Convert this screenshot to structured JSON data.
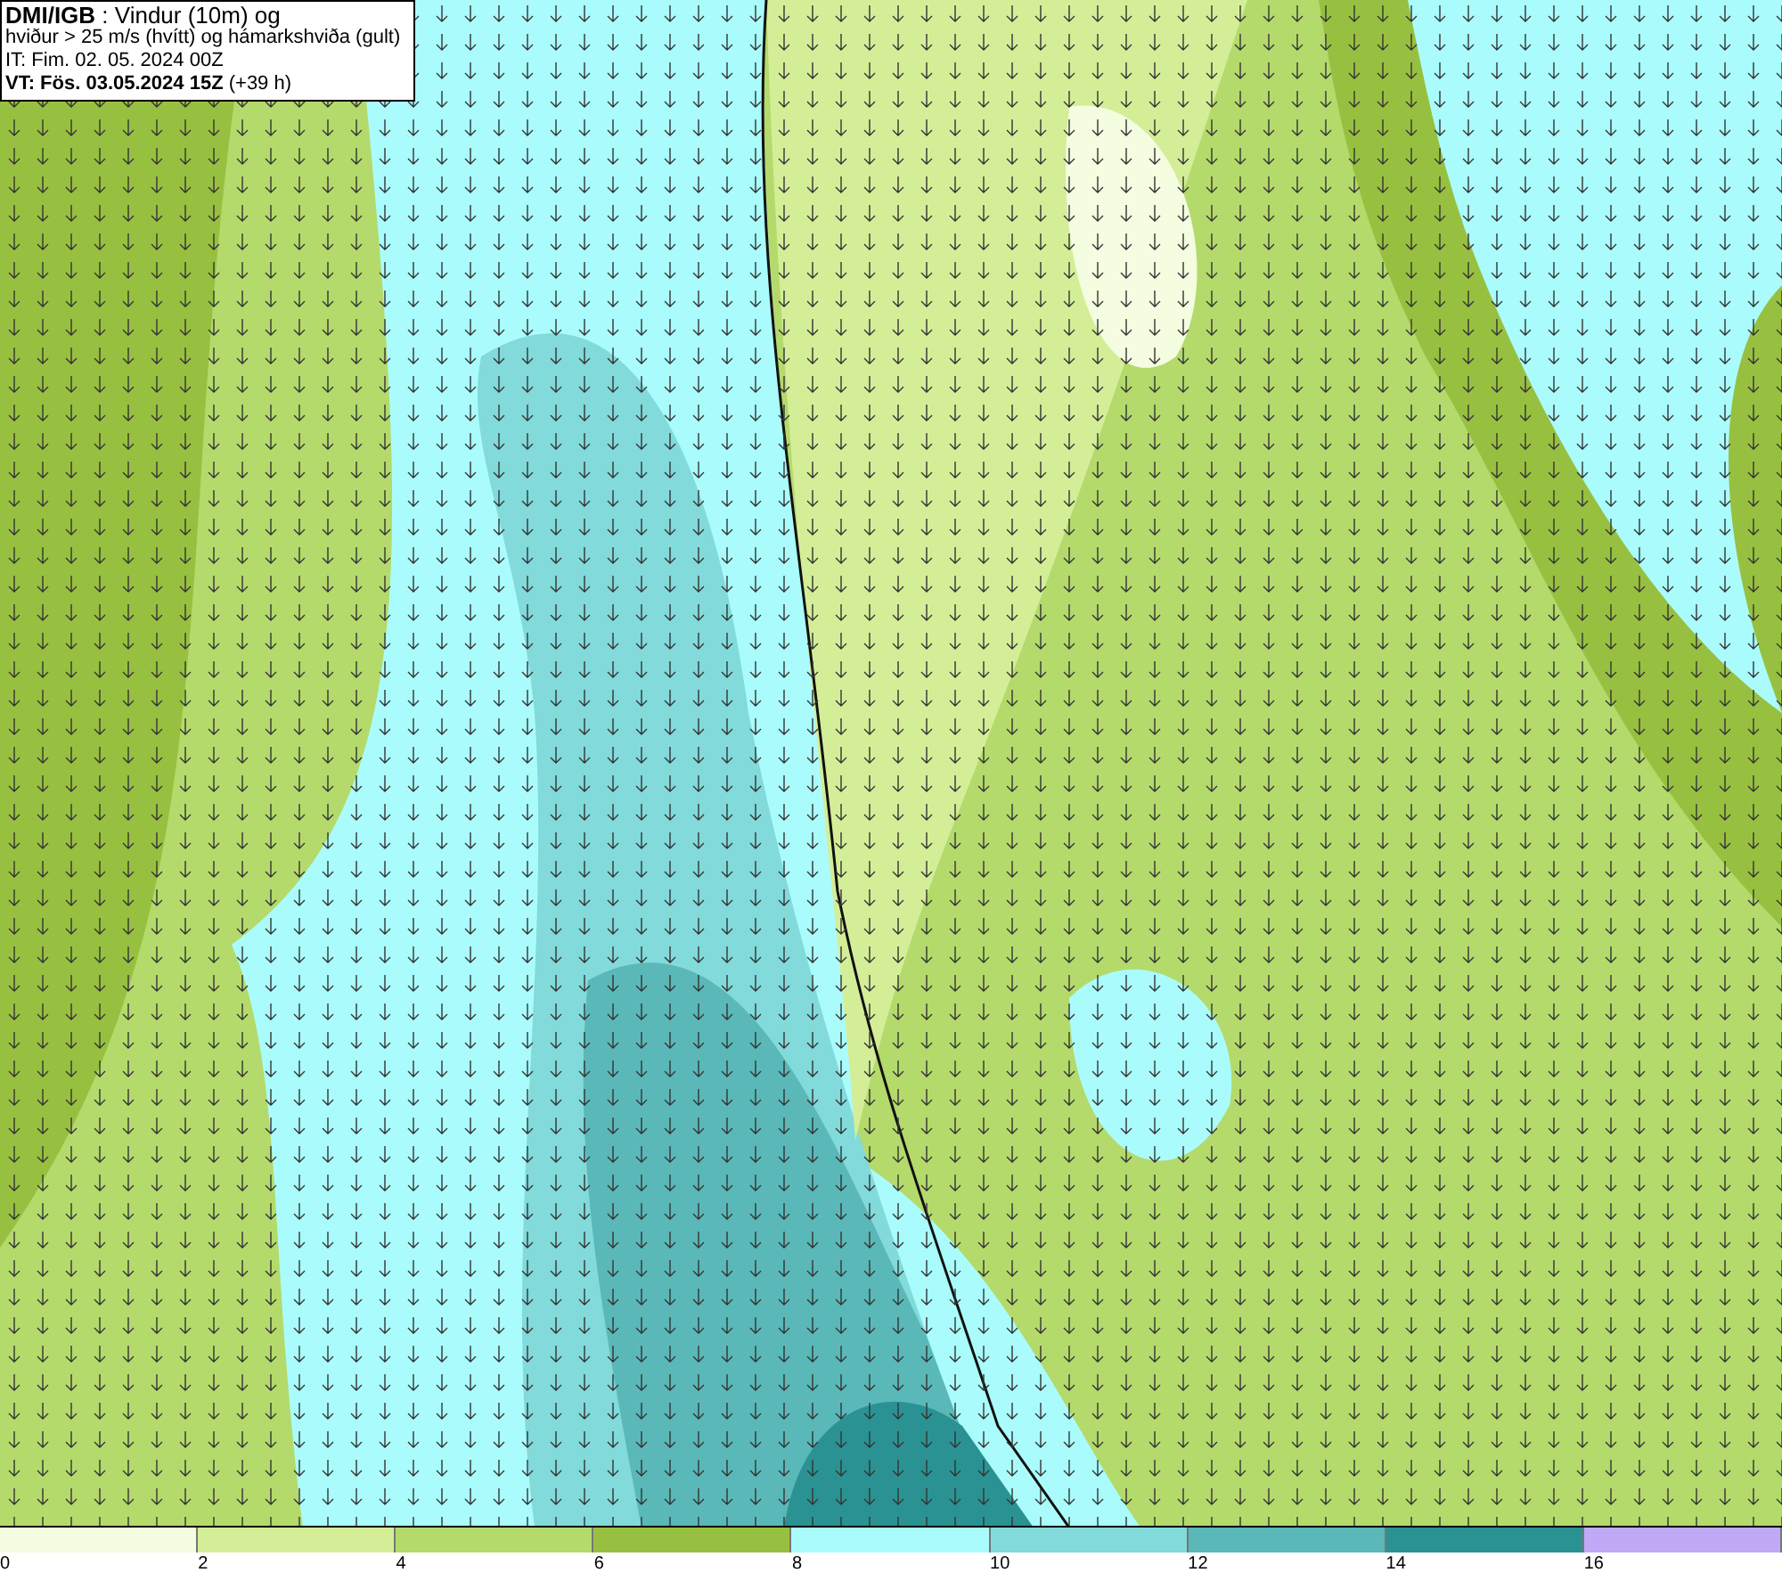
{
  "info_box": {
    "lines": [
      "**DMI/IGB** : Vindur (10m) og",
      "hviður > 25 m/s (hvítt) og hámarkshviða (gult)",
      "IT: Fim. 02. 05. 2024 00Z",
      "**VT: Fös. 03.05.2024 15Z** (+39 h)"
    ]
  },
  "legend": [
    {
      "label": "0",
      "color": "#f4fde0"
    },
    {
      "label": "2",
      "color": "#d4ee98"
    },
    {
      "label": "4",
      "color": "#b4da6c"
    },
    {
      "label": "6",
      "color": "#98c040"
    },
    {
      "label": "8",
      "color": "#aafcfc"
    },
    {
      "label": "10",
      "color": "#82dada"
    },
    {
      "label": "12",
      "color": "#5ab8b8"
    },
    {
      "label": "14",
      "color": "#2a9292"
    },
    {
      "label": "16",
      "color": "#c0aaf8"
    }
  ]
}
